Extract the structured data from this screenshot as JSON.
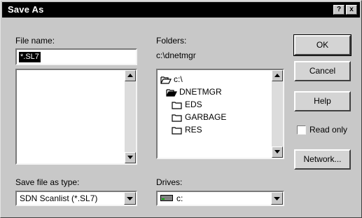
{
  "window": {
    "title": "Save As",
    "help_button": "?",
    "close_button": "x"
  },
  "file_name": {
    "label": "File name:",
    "value": "*.SL7"
  },
  "file_list": {
    "items": []
  },
  "folders": {
    "label": "Folders:",
    "current_path": "c:\\dnetmgr",
    "items": [
      {
        "name": "c:\\",
        "icon": "open-folder-icon",
        "level": 0
      },
      {
        "name": "DNETMGR",
        "icon": "open-folder-icon",
        "level": 1
      },
      {
        "name": "EDS",
        "icon": "folder-icon",
        "level": 2
      },
      {
        "name": "GARBAGE",
        "icon": "folder-icon",
        "level": 2
      },
      {
        "name": "RES",
        "icon": "folder-icon",
        "level": 2
      }
    ]
  },
  "save_type": {
    "label": "Save file as type:",
    "value": "SDN Scanlist (*.SL7)"
  },
  "drives": {
    "label": "Drives:",
    "value": "c:",
    "icon": "drive-icon"
  },
  "buttons": {
    "ok": "OK",
    "cancel": "Cancel",
    "help": "Help",
    "network": "Network..."
  },
  "read_only": {
    "label": "Read only",
    "checked": false
  },
  "colors": {
    "titlebar": "#000000",
    "dialog_face": "#c8c8c8",
    "selection": "#000000"
  }
}
